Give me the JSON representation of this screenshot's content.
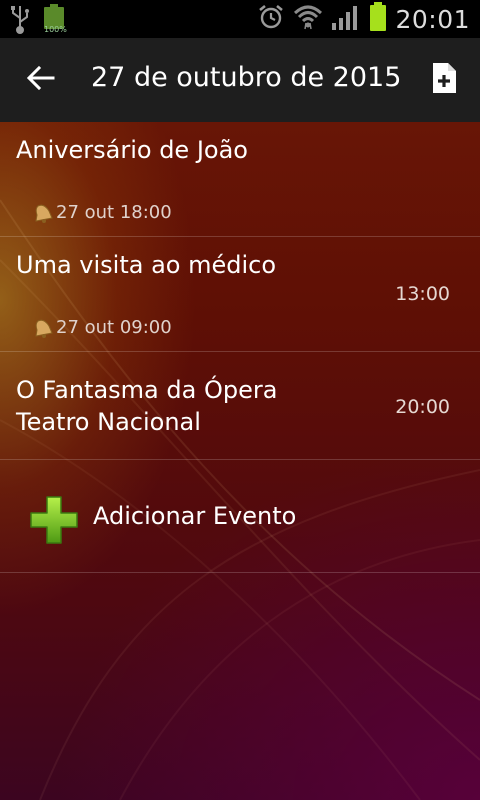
{
  "status_bar": {
    "left_icons": [
      "usb-icon",
      "battery-full-icon"
    ],
    "battery_label": "100%",
    "right_icons": [
      "alarm-icon",
      "wifi-icon",
      "signal-icon",
      "battery-icon"
    ],
    "time": "20:01"
  },
  "action_bar": {
    "back_icon": "arrow-left-icon",
    "title": "27 de outubro de 2015",
    "new_icon": "new-document-icon"
  },
  "events": [
    {
      "title": "Aniversário de João",
      "time": "",
      "reminder": "27 out 18:00"
    },
    {
      "title": "Uma visita ao médico",
      "time": "13:00",
      "reminder": "27 out 09:00"
    },
    {
      "title": "O Fantasma da Ópera",
      "subtitle": "Teatro Nacional",
      "time": "20:00"
    }
  ],
  "add_event": {
    "label": "Adicionar Evento",
    "icon": "plus-icon"
  },
  "colors": {
    "status_bar_bg": "#000000",
    "action_bar_bg": "#1e1e1e",
    "plus_green": "#7ccc2a",
    "battery_green": "#a6e01c"
  }
}
